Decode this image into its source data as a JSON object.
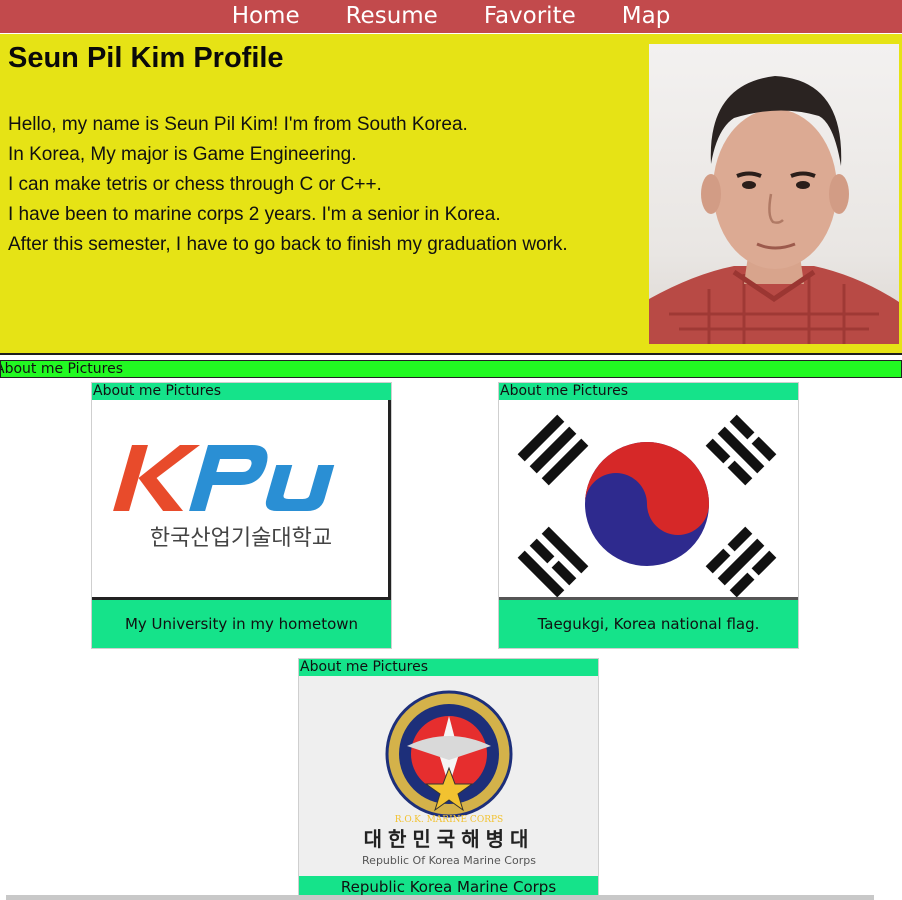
{
  "nav": {
    "items": [
      {
        "label": "Home"
      },
      {
        "label": "Resume"
      },
      {
        "label": "Favorite"
      },
      {
        "label": "Map"
      }
    ]
  },
  "profile": {
    "title": "Seun Pil Kim Profile",
    "bio": [
      "Hello, my name is Seun Pil Kim! I'm from South Korea.",
      "In Korea, My major is Game Engineering.",
      "I can make tetris or chess through C or C++.",
      "I have been to marine corps 2 years. I'm a senior in Korea.",
      "After this semester, I have to go back to finish my graduation work."
    ]
  },
  "gallery": {
    "section_label": "About me Pictures",
    "cards": [
      {
        "top_caption": "About me Pictures",
        "bottom_caption": "My University in my hometown",
        "image_logo_text": "KPU",
        "image_sub_text": "한국산업기술대학교"
      },
      {
        "top_caption": "About me Pictures",
        "bottom_caption": "Taegukgi, Korea national flag."
      },
      {
        "top_caption": "About me Pictures",
        "bottom_caption": "Republic Korea Marine Corps",
        "image_emblem_text": "R.O.K. MARINE CORPS",
        "image_korean_text": "대한민국해병대",
        "image_sub_text": "Republic Of Korea Marine Corps"
      }
    ]
  },
  "colors": {
    "nav_bg": "#c24a4c",
    "hero_bg": "#e6e315",
    "section_bar": "#22f922",
    "caption_bg": "#15e38a"
  }
}
